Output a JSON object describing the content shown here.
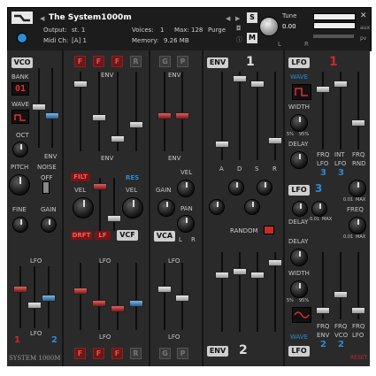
{
  "header": {
    "instrument_name": "The System1000m",
    "output_label": "Output:",
    "output_value": "st. 1",
    "midi_label": "Midi Ch:",
    "midi_value": "[A] 1",
    "voices_label": "Voices:",
    "voices_value": "1",
    "max_label": "Max:",
    "max_value": "128",
    "purge_label": "Purge",
    "memory_label": "Memory:",
    "memory_value": "9.26 MB",
    "tune_label": "Tune",
    "tune_value": "0.00",
    "solo_label": "S",
    "mute_label": "M",
    "aux_label": "aux",
    "pv_label": "pv",
    "left_value": "L",
    "right_value": "R"
  },
  "vco": {
    "title": "VCO",
    "bank_label": "BANK",
    "bank_value": "01",
    "wave_label": "WAVE",
    "oct_label": "OCT",
    "pitch_label": "PITCH",
    "noise_label": "NOISE",
    "noise_off": "OFF",
    "fine_label": "FINE",
    "gain_label": "GAIN",
    "env_label": "ENV",
    "lfo_label": "LFO",
    "num_1": "1",
    "num_2": "2",
    "footer": "SYSTEM 1000M"
  },
  "vcf": {
    "buttons": [
      "F",
      "F",
      "F",
      "R"
    ],
    "env_label": "ENV",
    "filt_label": "FILT",
    "res_label": "RES",
    "vel_label": "VEL",
    "vel2_label": "VEL",
    "drft_label": "DRFT",
    "lf_label": "LF",
    "title": "VCF",
    "lfo_label": "LFO",
    "bottom_buttons": [
      "F",
      "F",
      "F",
      "R"
    ]
  },
  "vca": {
    "buttons": [
      "G",
      "P"
    ],
    "env_label": "ENV",
    "vel_label": "VEL",
    "gain_label": "GAIN",
    "pan_label": "PAN",
    "l_label": "L",
    "r_label": "R",
    "title": "VCA",
    "lfo_label": "LFO",
    "bottom_buttons": [
      "G",
      "P"
    ]
  },
  "env": {
    "title": "ENV",
    "number": "1",
    "adsr": [
      "A",
      "D",
      "S",
      "R"
    ],
    "random_label": "RANDOM",
    "bottom_title": "ENV",
    "bottom_number": "2"
  },
  "lfo": {
    "title": "LFO",
    "number": "1",
    "wave_label": "WAVE",
    "width_label": "WIDTH",
    "pct_min": "5%",
    "pct_max": "95%",
    "delay_label": "DELAY",
    "frq_label": "FRQ",
    "int_label": "INT",
    "frq2_label": "FRQ",
    "lfo_col_label": "LFO",
    "lfo_col_label2": "LFO",
    "rnd_label": "RND",
    "num_3a": "3",
    "num_3b": "3",
    "title2": "LFO",
    "number2": "3",
    "freq_label": "FREQ",
    "delay2_label": "DELAY",
    "max_label": "MAX",
    "min_value": "0.01",
    "delay3_label": "DELAY",
    "width2_label": "WIDTH",
    "pct_min2": "5%",
    "pct_max2": "95%",
    "frq3_label": "FRQ",
    "frq4_label": "FRQ",
    "frq5_label": "FRQ",
    "env_label": "ENV",
    "vco_label": "VCO",
    "lfo2_label": "LFO",
    "wave2_label": "WAVE",
    "bottom_title": "LFO",
    "num_2a": "2",
    "num_2b": "2",
    "reset_label": "RESET"
  },
  "colors": {
    "panel": "#2a2a2a",
    "accent_blue": "#2b8ad6",
    "accent_red": "#c92a2a",
    "header": "#1c1c1c"
  }
}
